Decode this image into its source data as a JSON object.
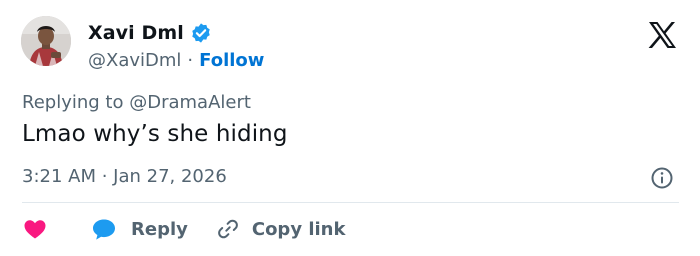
{
  "user": {
    "display_name": "Xavi Dml",
    "handle": "@XaviDml",
    "follow_label": "Follow"
  },
  "tweet": {
    "reply_prefix": "Replying to",
    "reply_mention": "@DramaAlert",
    "text": "Lmao why’s she hiding",
    "timestamp": "3:21 AM · Jan 27, 2026"
  },
  "actions": {
    "reply_label": "Reply",
    "copy_link_label": "Copy link"
  },
  "icons": {
    "verified": "verified-badge-icon",
    "logo": "x-logo-icon",
    "info": "info-icon",
    "like": "heart-icon",
    "reply": "chat-bubble-icon",
    "copy": "link-icon"
  },
  "colors": {
    "text": "#0f1419",
    "secondary": "#536471",
    "link": "#0074d4",
    "verified": "#1d9bf0",
    "heart": "#f91880",
    "divider": "#e1e8ed"
  }
}
